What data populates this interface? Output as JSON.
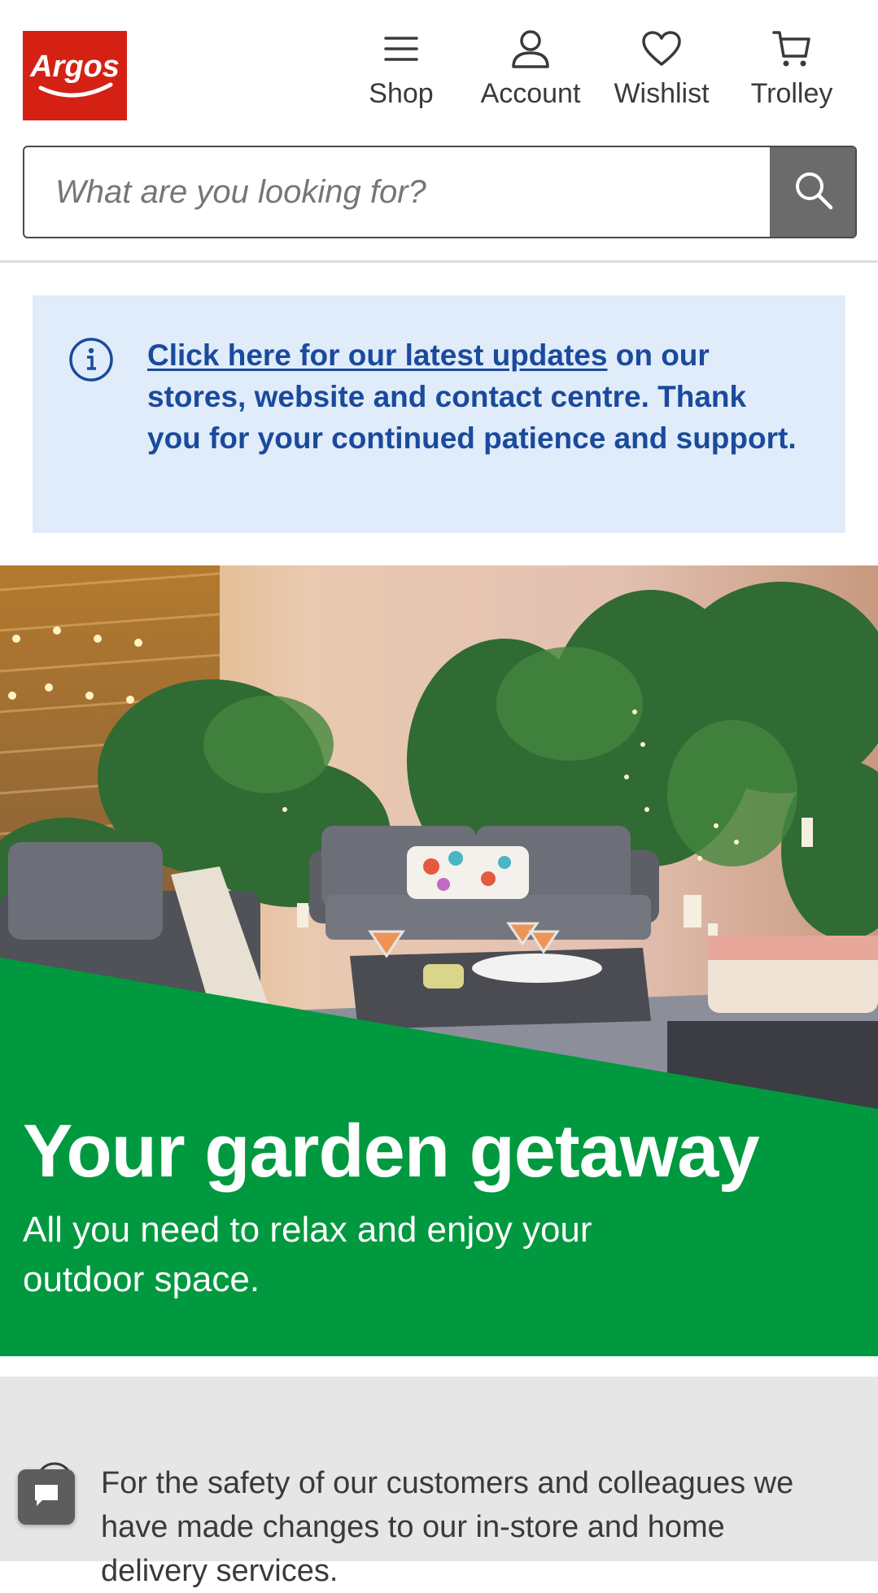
{
  "header": {
    "logo_text": "Argos",
    "nav": [
      {
        "label": "Shop",
        "icon": "menu-icon"
      },
      {
        "label": "Account",
        "icon": "account-icon"
      },
      {
        "label": "Wishlist",
        "icon": "heart-icon"
      },
      {
        "label": "Trolley",
        "icon": "trolley-icon"
      }
    ],
    "search": {
      "placeholder": "What are you looking for?",
      "value": "",
      "button_icon": "search-icon"
    }
  },
  "notice": {
    "icon": "info-icon",
    "link_text": "Click here for our latest updates",
    "body_text": " on our stores, website and contact centre. Thank you for your continued patience and support."
  },
  "hero": {
    "title": "Your garden getaway",
    "subtitle": "All you need to relax and enjoy your outdoor space."
  },
  "safety": {
    "text": "For the safety of our customers and colleagues we have made changes to our in-store and home delivery services."
  },
  "chat": {
    "icon": "chat-icon"
  },
  "colors": {
    "brand_red": "#d42114",
    "notice_bg": "#e0ecfa",
    "notice_text": "#1a4a9c",
    "hero_green": "#00993f",
    "search_button": "#6b6b6b"
  }
}
